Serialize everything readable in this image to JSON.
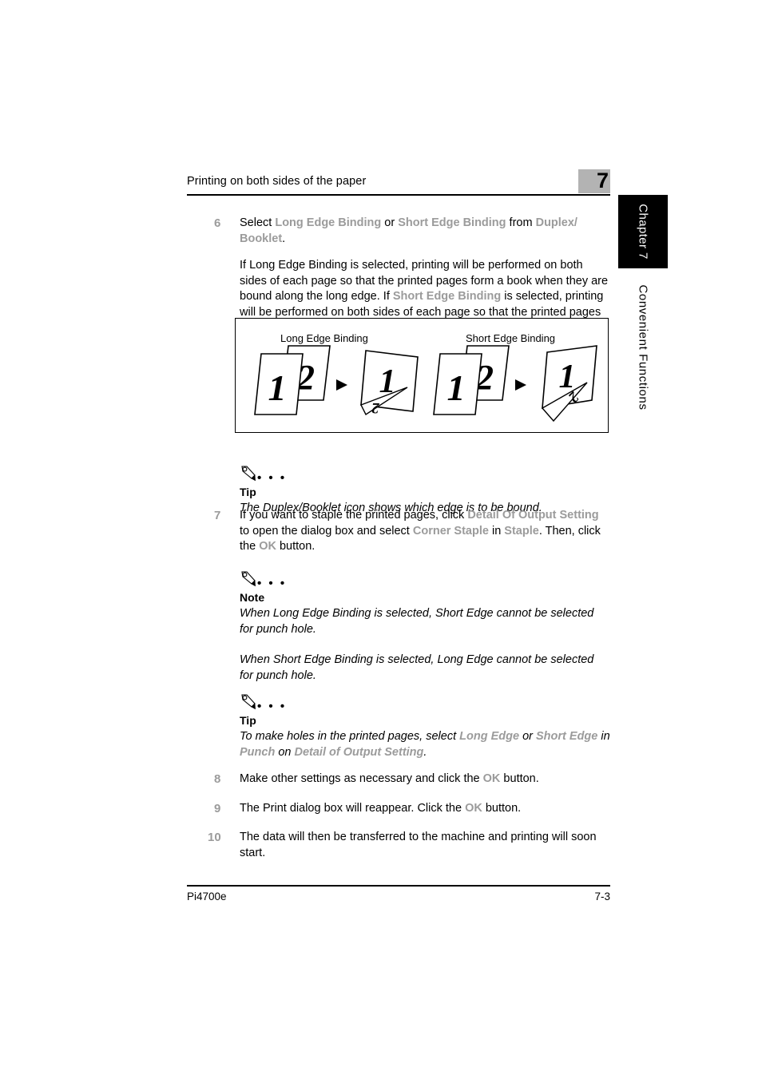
{
  "header": {
    "title": "Printing on both sides of the paper",
    "chapter_number": "7"
  },
  "side_tabs": {
    "chapter_tab": "Chapter 7",
    "section_tab": "Convenient Functions"
  },
  "steps": {
    "step6": {
      "number": "6",
      "text_1": "Select ",
      "ui_1": "Long Edge Binding",
      "text_2": " or ",
      "ui_2": "Short Edge Binding",
      "text_3": " from ",
      "ui_3": "Duplex/ Booklet",
      "text_4": "."
    },
    "step6_para": {
      "text_1": "If Long Edge Binding is selected, printing will be performed on both sides of each page so that the printed pages form a book when they are bound along the long edge. If ",
      "ui_1": "Short Edge Binding",
      "text_2": " is selected, printing will be performed on both sides of each page so that the printed pages form a book when they are bound along the short edge."
    },
    "step7": {
      "number": "7",
      "text_1": "If you want to staple the printed pages, click ",
      "ui_1": "Detail Of Output Setting",
      "text_2": " to open the dialog box and select ",
      "ui_2": "Corner Staple",
      "text_3": " in ",
      "ui_3": "Staple",
      "text_4": ". Then, click the ",
      "ui_4": "OK",
      "text_5": " button."
    },
    "step8": {
      "number": "8",
      "text_1": "Make other settings as necessary and click the ",
      "ui_1": "OK",
      "text_2": " button."
    },
    "step9": {
      "number": "9",
      "text_1": "The Print dialog box will reappear. Click the ",
      "ui_1": "OK",
      "text_2": " button."
    },
    "step10": {
      "number": "10",
      "text_1": "The data will then be transferred to the machine and printing will soon start."
    }
  },
  "figure": {
    "label_left": "Long Edge Binding",
    "label_right": "Short Edge Binding",
    "sheet_front_number": "1",
    "sheet_back_number": "2",
    "arrow_glyph": "▶"
  },
  "notes": {
    "tip1": {
      "title": "Tip",
      "dots": "• • •",
      "text": "The Duplex/Booklet icon shows which edge is to be bound."
    },
    "note1": {
      "title": "Note",
      "dots": "• • •",
      "text_1": "When Long Edge Binding is selected, Short Edge cannot be selected for punch hole.",
      "text_2": "When Short Edge Binding is selected, Long Edge cannot be selected for punch hole."
    },
    "tip2": {
      "title": "Tip",
      "dots": "• • •",
      "text_1": "To make holes in the printed pages, select ",
      "ui_1": "Long Edge",
      "text_2": " or ",
      "ui_2": "Short Edge",
      "text_3": " in ",
      "ui_3": "Punch",
      "text_4": " on ",
      "ui_4": "Detail of Output Setting",
      "text_5": "."
    }
  },
  "footer": {
    "model": "Pi4700e",
    "page_number": "7-3"
  },
  "colors": {
    "ui_gray": "#9b9b9b",
    "chapter_box_gray": "#b3b3b3",
    "tab_black": "#000000",
    "text_black": "#000000"
  }
}
